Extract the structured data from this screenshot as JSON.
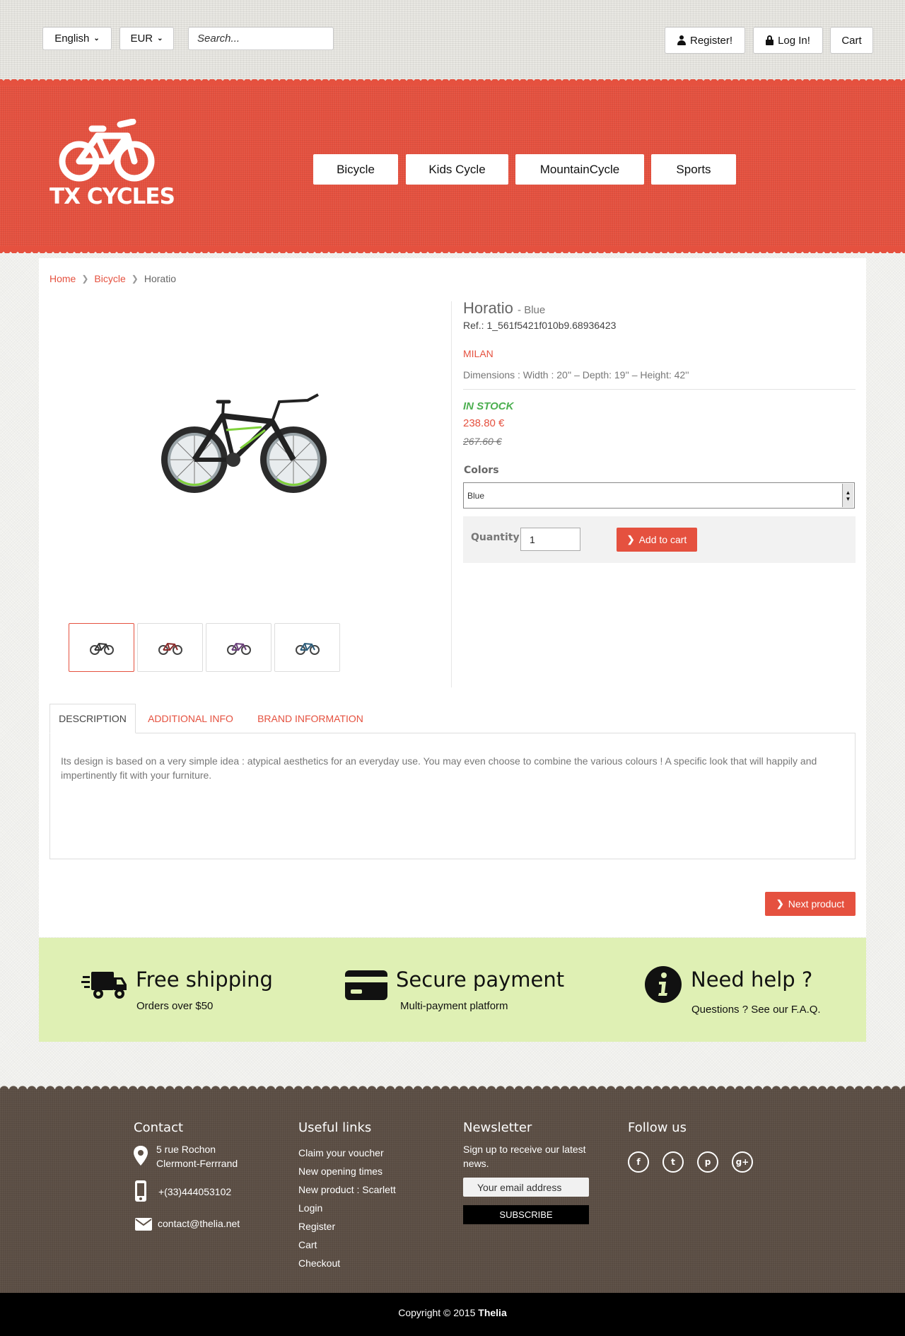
{
  "topbar": {
    "language": "English",
    "currency": "EUR",
    "search_placeholder": "Search...",
    "register_label": "Register!",
    "login_label": "Log In!",
    "cart_label": "Cart"
  },
  "brand": {
    "logo_text": "TX CYCLES"
  },
  "nav": [
    "Bicycle",
    "Kids Cycle",
    "MountainCycle",
    "Sports"
  ],
  "breadcrumb": [
    "Home",
    "Bicycle",
    "Horatio"
  ],
  "product": {
    "name": "Horatio",
    "variant": "- Blue",
    "ref": "Ref.: 1_561f5421f010b9.68936423",
    "brand": "MILAN",
    "dimensions": "Dimensions : Width : 20'' – Depth: 19'' – Height: 42''",
    "stock": "IN STOCK",
    "price": "238.80 €",
    "old_price": "267.60 €",
    "colors_label": "Colors",
    "color_selected": "Blue",
    "quantity_label": "Quantity",
    "quantity_value": "1",
    "add_to_cart": "Add to cart",
    "thumbnail_count": 4
  },
  "tabs": [
    "DESCRIPTION",
    "ADDITIONAL INFO",
    "BRAND INFORMATION"
  ],
  "description": "Its design is based on a very simple idea : atypical aesthetics for an everyday use. You may even choose to combine the various colours ! A specific look that will happily and impertinently fit with your furniture.",
  "next_product": "Next product",
  "features": [
    {
      "title": "Free shipping",
      "subtitle": "Orders over $50",
      "icon": "truck-icon"
    },
    {
      "title": "Secure payment",
      "subtitle": "Multi-payment platform",
      "icon": "credit-card-icon"
    },
    {
      "title": "Need help ?",
      "subtitle": "Questions ? See our F.A.Q.",
      "icon": "info-icon"
    }
  ],
  "footer": {
    "contact_title": "Contact",
    "address_line1": "5 rue Rochon",
    "address_line2": "Clermont-Ferrrand",
    "phone": "+(33)444053102",
    "email": "contact@thelia.net",
    "links_title": "Useful links",
    "links": [
      "Claim your voucher",
      "New opening times",
      "New product : Scarlett",
      "Login",
      "Register",
      "Cart",
      "Checkout"
    ],
    "newsletter_title": "Newsletter",
    "newsletter_text": "Sign up to receive our latest news.",
    "newsletter_placeholder": "Your email address",
    "subscribe_label": "SUBSCRIBE",
    "follow_title": "Follow us",
    "social": [
      "f",
      "t",
      "p",
      "g+"
    ]
  },
  "copyright": {
    "text": "Copyright © 2015",
    "brand": "Thelia"
  },
  "colors": {
    "accent": "#e5513f",
    "features_bg": "#dff0b4",
    "footer_bg": "#5c4f45",
    "stock": "#4caf50"
  }
}
